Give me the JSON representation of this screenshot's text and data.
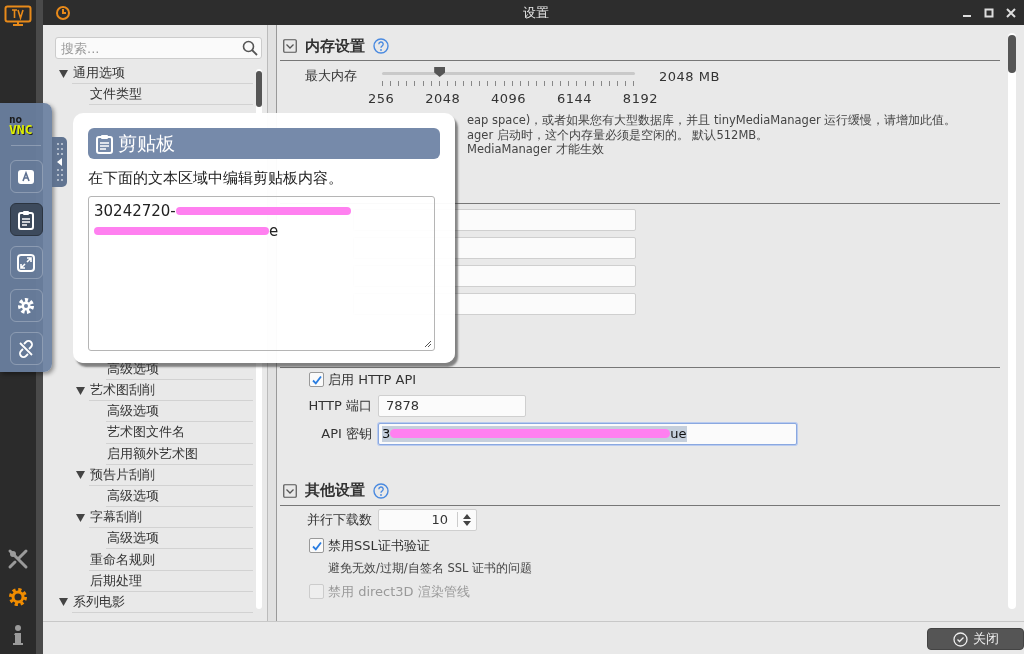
{
  "window": {
    "title": "设置"
  },
  "search": {
    "placeholder": "搜索..."
  },
  "tree": [
    {
      "label": "通用选项",
      "expanded": true,
      "selected": false,
      "children": [
        {
          "label": "文件类型",
          "selected": false
        }
      ]
    },
    {
      "children": [
        {
          "children": [
            {
              "label": "高级选项",
              "selected": false
            }
          ]
        },
        {
          "label": "艺术图刮削",
          "expanded": true,
          "selected": false,
          "children": [
            {
              "label": "高级选项",
              "selected": false
            },
            {
              "label": "艺术图文件名",
              "selected": false
            },
            {
              "label": "启用额外艺术图",
              "selected": false
            }
          ]
        },
        {
          "label": "预告片刮削",
          "expanded": true,
          "selected": false,
          "children": [
            {
              "label": "高级选项",
              "selected": false
            }
          ]
        },
        {
          "label": "字幕刮削",
          "expanded": true,
          "selected": false,
          "children": [
            {
              "label": "高级选项",
              "selected": false
            }
          ]
        },
        {
          "label": "重命名规则",
          "selected": false
        },
        {
          "label": "后期处理",
          "selected": false
        }
      ]
    },
    {
      "label": "系列电影",
      "expanded": true,
      "selected": false
    }
  ],
  "memory": {
    "title": "内存设置",
    "label": "最大内存",
    "level": 0.226,
    "reading": "2048 MB",
    "ticks": [
      "256",
      "2048",
      "4096",
      "6144",
      "8192"
    ],
    "description": [
      "eap space)，或者如果您有大型数据库，并且 tinyMediaManager 运行缓慢，请增加此值。",
      "ager 启动时，这个内存量必须是空闲的。 默认512MB。",
      "MediaManager 才能生效"
    ]
  },
  "http_api": {
    "enable": {
      "label": "启用 HTTP API",
      "checked": true
    },
    "port": {
      "label": "HTTP 端口",
      "value": "7878"
    },
    "key": {
      "label": "API 密钥",
      "value_start": "3",
      "value_end": "ue",
      "focused": true
    }
  },
  "other": {
    "title": "其他设置",
    "downloads": {
      "label": "并行下载数",
      "value": "10"
    },
    "checks": [
      {
        "label": "禁用SSL证书验证",
        "checked": true,
        "disabled": false,
        "hint": "避免无效/过期/自签名 SSL 证书的问题"
      },
      {
        "label": "禁用 direct3D 渲染管线",
        "checked": false,
        "disabled": true
      }
    ]
  },
  "footer": {
    "close": "关闭"
  },
  "novnc": {
    "logo_top": "no",
    "logo_bottom": "VNC",
    "buttons": [
      {
        "kind": "keyboard",
        "selected": false
      },
      {
        "kind": "clipboard",
        "selected": true
      },
      {
        "kind": "fullscreen",
        "selected": false
      },
      {
        "kind": "settings",
        "selected": false
      },
      {
        "kind": "disconnect",
        "selected": false
      }
    ]
  },
  "clipboard": {
    "title": "剪贴板",
    "description": "在下面的文本区域中编辑剪贴板内容。",
    "lines": [
      {
        "start": "30242720-"
      },
      {
        "end": "e"
      }
    ]
  }
}
